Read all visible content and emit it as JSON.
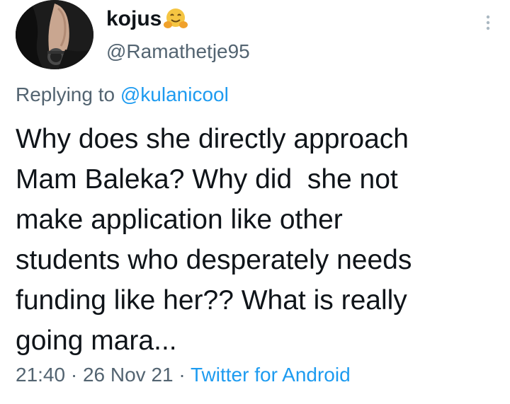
{
  "author": {
    "display_name": "kojus",
    "handle": "@Ramathetje95",
    "emoji_icon": "hugging-face-emoji"
  },
  "reply": {
    "prefix": "Replying to",
    "mention": "@kulanicool"
  },
  "tweet": {
    "lines": [
      "Why does she directly approach",
      "Mam Baleka? Why did  she not",
      "make application like other",
      "students who desperately needs",
      "funding like her?? What is really",
      "going mara..."
    ]
  },
  "meta": {
    "time": "21:40",
    "date": "26 Nov 21",
    "source": "Twitter for Android",
    "separator": "·"
  },
  "colors": {
    "text": "#0f1419",
    "secondary": "#536471",
    "link": "#1d9bf0"
  }
}
